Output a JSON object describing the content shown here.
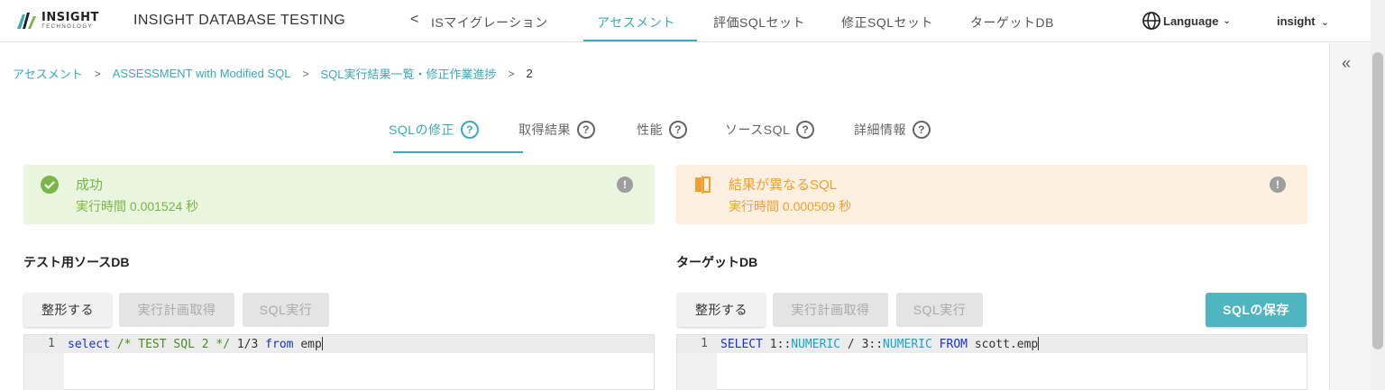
{
  "header": {
    "logo_text": "INSIGHT",
    "logo_sub": "TECHNOLOGY",
    "app_title": "INSIGHT DATABASE TESTING",
    "back_label": "<",
    "nav": [
      "ISマイグレーション",
      "アセスメント",
      "評価SQLセット",
      "修正SQLセット",
      "ターゲットDB"
    ],
    "active_nav": "アセスメント",
    "language_label": "Language",
    "user_label": "insight"
  },
  "breadcrumb": {
    "items": [
      "アセスメント",
      "ASSESSMENT with Modified SQL",
      "SQL実行結果一覧・修正作業進捗",
      "2"
    ],
    "separator": ">"
  },
  "collapse_icon": "«",
  "tabs": {
    "items": [
      "SQLの修正",
      "取得結果",
      "性能",
      "ソースSQL",
      "詳細情報"
    ],
    "active": "SQLの修正",
    "help_glyph": "?"
  },
  "source_status": {
    "title": "成功",
    "time": "実行時間 0.001524 秒",
    "color": "#7ab648",
    "bg": "#e9f5de",
    "icon": "check-circle-icon"
  },
  "target_status": {
    "title": "結果が異なるSQL",
    "time": "実行時間 0.000509 秒",
    "color": "#f0a030",
    "bg": "#fdf0e1",
    "icon": "compare-icon"
  },
  "info_glyph": "!",
  "source_panel": {
    "heading": "テスト用ソースDB",
    "buttons": {
      "format": "整形する",
      "plan": "実行計画取得",
      "run": "SQL実行"
    },
    "line_number": "1",
    "code": {
      "kw1": "select",
      "comment": "/* TEST SQL 2 */",
      "expr": "1/3",
      "kw2": "from",
      "table": "emp"
    }
  },
  "target_panel": {
    "heading": "ターゲットDB",
    "buttons": {
      "format": "整形する",
      "plan": "実行計画取得",
      "run": "SQL実行",
      "save": "SQLの保存"
    },
    "line_number": "1",
    "code": {
      "kw1": "SELECT",
      "n1": "1::",
      "type1": "NUMERIC",
      "op": "/",
      "n2": "3::",
      "type2": "NUMERIC",
      "kw2": "FROM",
      "table": "scott.emp"
    }
  },
  "colors": {
    "accent": "#3aa9b8",
    "primary_button": "#4fb5c1"
  }
}
